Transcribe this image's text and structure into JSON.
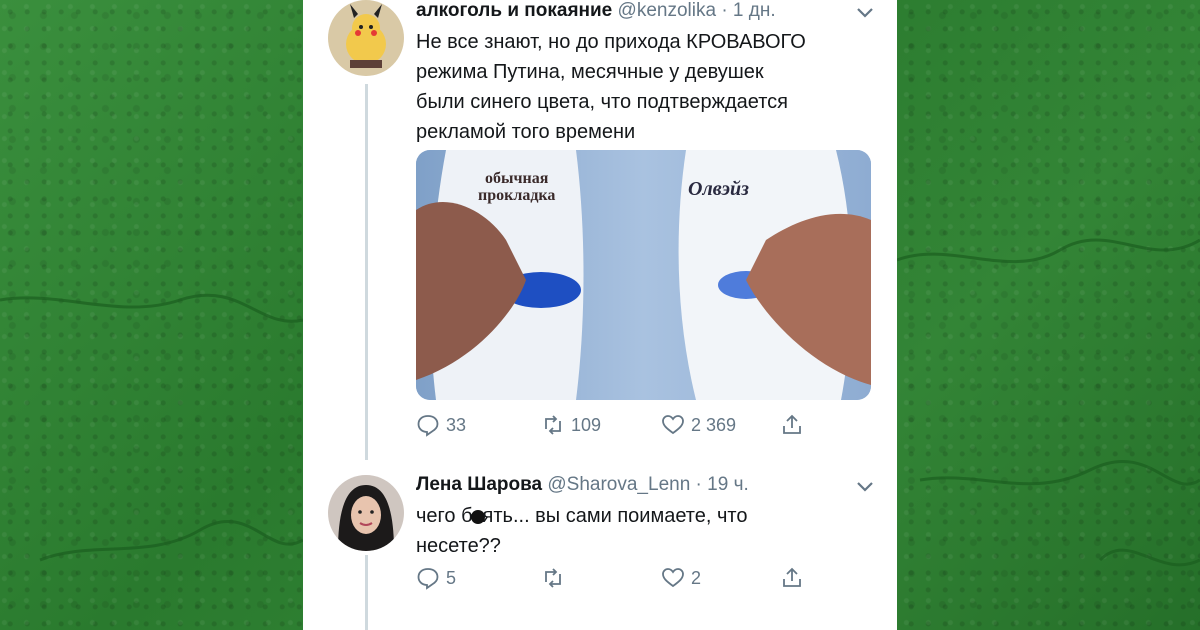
{
  "tweet1": {
    "display_name": "алкоголь и покаяние",
    "handle": "@kenzolika",
    "time": "· 1 дн.",
    "text_lines": [
      "Не все знают, но до прихода КРОВАВОГО",
      "режима Путина, месячные у девушек",
      "были синего цвета, что подтверждается",
      "рекламой того времени"
    ],
    "media": {
      "left_label_line1": "обычная",
      "left_label_line2": "прокладка",
      "right_label": "Олвэйз"
    },
    "replies": "33",
    "retweets": "109",
    "likes": "2 369"
  },
  "tweet2": {
    "display_name": "Лена Шарова",
    "handle": "@Sharova_Lenn",
    "time": "· 19 ч.",
    "text_line1_a": "чего б",
    "text_line1_b": "ять... вы сами поимаете, что",
    "text_line2": "несете??",
    "replies": "5",
    "retweets": "",
    "likes": "2"
  },
  "icons": [
    "reply-icon",
    "retweet-icon",
    "like-icon",
    "share-icon",
    "chevron-down-icon"
  ],
  "colors": {
    "background_green": "#2e7d32",
    "text": "#14171a",
    "meta": "#657786",
    "line": "#cfd9de"
  }
}
